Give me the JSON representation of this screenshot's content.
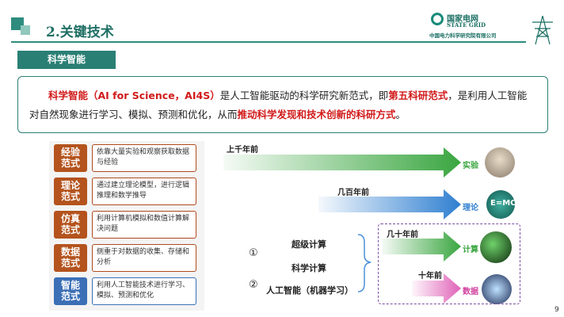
{
  "header": {
    "title": "2.关键技术",
    "logo_cn": "国家电网",
    "logo_en": "STATE GRID",
    "logo_sub": "中国电力科学研究院有限公司"
  },
  "section_tab": "科学智能",
  "definition": {
    "p1": "科学智能（AI for Science，AI4S）",
    "p2": "是人工智能驱动的科学研究新范式，即",
    "p3": "第五科研范式",
    "p4": "，是利用人工智能对自然现象进行学习、模拟、预测和优化，从而",
    "p5": "推动科学发现和技术创新的科研方式",
    "p6": "。"
  },
  "paradigms": [
    {
      "badge_l1": "经验",
      "badge_l2": "范式",
      "desc": "依靠大量实验和观察获取数据与经验"
    },
    {
      "badge_l1": "理论",
      "badge_l2": "范式",
      "desc": "通过建立理论模型，进行逻辑推理和数学推导"
    },
    {
      "badge_l1": "仿真",
      "badge_l2": "范式",
      "desc": "利用计算机模拟和数值计算解决问题"
    },
    {
      "badge_l1": "数据",
      "badge_l2": "范式",
      "desc": "侧重于对数据的收集、存储和分析"
    },
    {
      "badge_l1": "智能",
      "badge_l2": "范式",
      "desc": "利用人工智能技术进行学习、模拟、预测和优化"
    }
  ],
  "timeline": {
    "t1": "上千年前",
    "t2": "几百年前",
    "t3": "几十年前",
    "t4": "十年前",
    "a1": "实验",
    "a2": "理论",
    "a3": "计算",
    "a4": "数据",
    "m1": "超级计算",
    "m2": "科学计算",
    "m3": "人工智能（机器学习）",
    "c1": "①",
    "c2": "②"
  },
  "page_number": "9",
  "colors": {
    "teal": "#2a7f74",
    "orange": "#b4531d",
    "blue": "#3b6fb6",
    "red": "#d11a1a",
    "arrow_green": "#3aa640",
    "arrow_blue": "#2f7fd0",
    "arrow_pink": "#e062b8"
  }
}
